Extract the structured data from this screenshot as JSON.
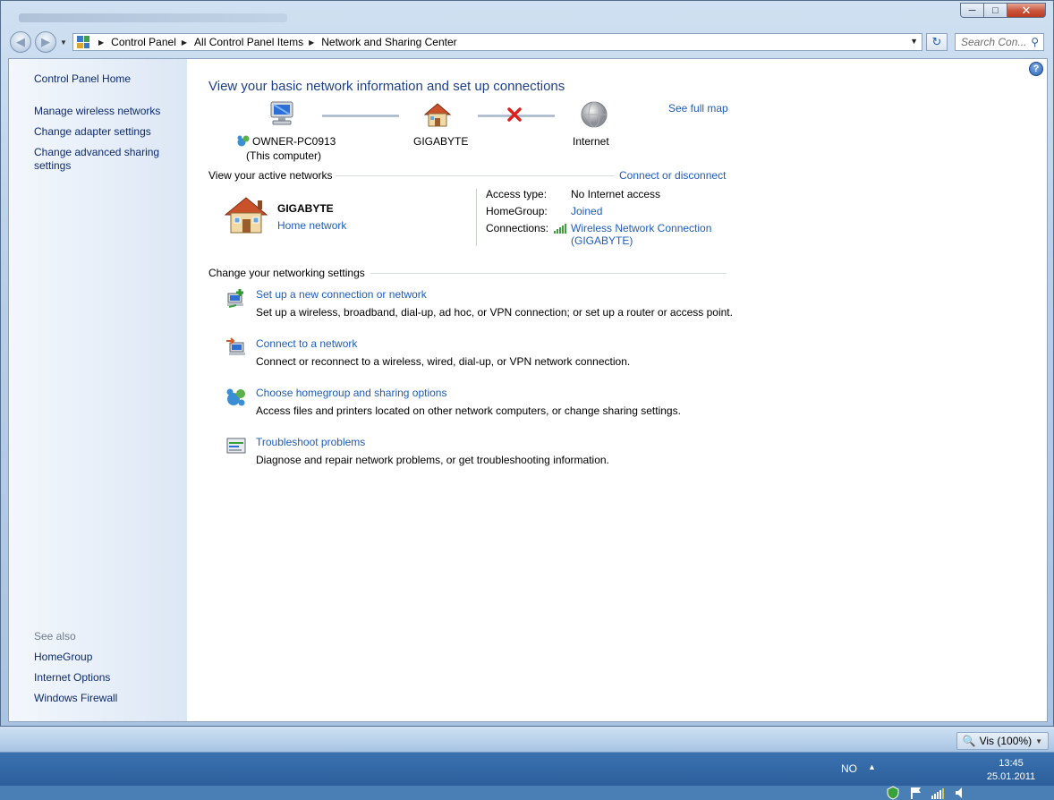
{
  "window": {
    "minimize_label": "─",
    "maximize_label": "□",
    "close_label": "✕"
  },
  "address": {
    "crumbs": [
      "Control Panel",
      "All Control Panel Items",
      "Network and Sharing Center"
    ],
    "search_placeholder": "Search Con..."
  },
  "sidebar": {
    "items": [
      "Control Panel Home",
      "Manage wireless networks",
      "Change adapter settings",
      "Change advanced sharing settings"
    ],
    "see_also_heading": "See also",
    "see_also": [
      "HomeGroup",
      "Internet Options",
      "Windows Firewall"
    ]
  },
  "main": {
    "title": "View your basic network information and set up connections",
    "see_full_map": "See full map",
    "map": {
      "computer_name": "OWNER-PC0913",
      "computer_sub": "(This computer)",
      "network": "GIGABYTE",
      "internet": "Internet"
    },
    "active_networks_label": "View your active networks",
    "connect_or_disconnect": "Connect or disconnect",
    "active": {
      "name": "GIGABYTE",
      "type": "Home network",
      "access_type_label": "Access type:",
      "access_type_value": "No Internet access",
      "homegroup_label": "HomeGroup:",
      "homegroup_value": "Joined",
      "connections_label": "Connections:",
      "connection_line1": "Wireless Network Connection",
      "connection_line2": "(GIGABYTE)"
    },
    "settings_label": "Change your networking settings",
    "tasks": [
      {
        "title": "Set up a new connection or network",
        "desc": "Set up a wireless, broadband, dial-up, ad hoc, or VPN connection; or set up a router or access point."
      },
      {
        "title": "Connect to a network",
        "desc": "Connect or reconnect to a wireless, wired, dial-up, or VPN network connection."
      },
      {
        "title": "Choose homegroup and sharing options",
        "desc": "Access files and printers located on other network computers, or change sharing settings."
      },
      {
        "title": "Troubleshoot problems",
        "desc": "Diagnose and repair network problems, or get troubleshooting information."
      }
    ]
  },
  "taskbar": {
    "zoom_label": "Vis (100%)",
    "language": "NO",
    "time": "13:45",
    "date": "25.01.2011"
  },
  "colors": {
    "link": "#1f5cb8",
    "title": "#1e3f8a",
    "error_x": "#d8231f"
  }
}
